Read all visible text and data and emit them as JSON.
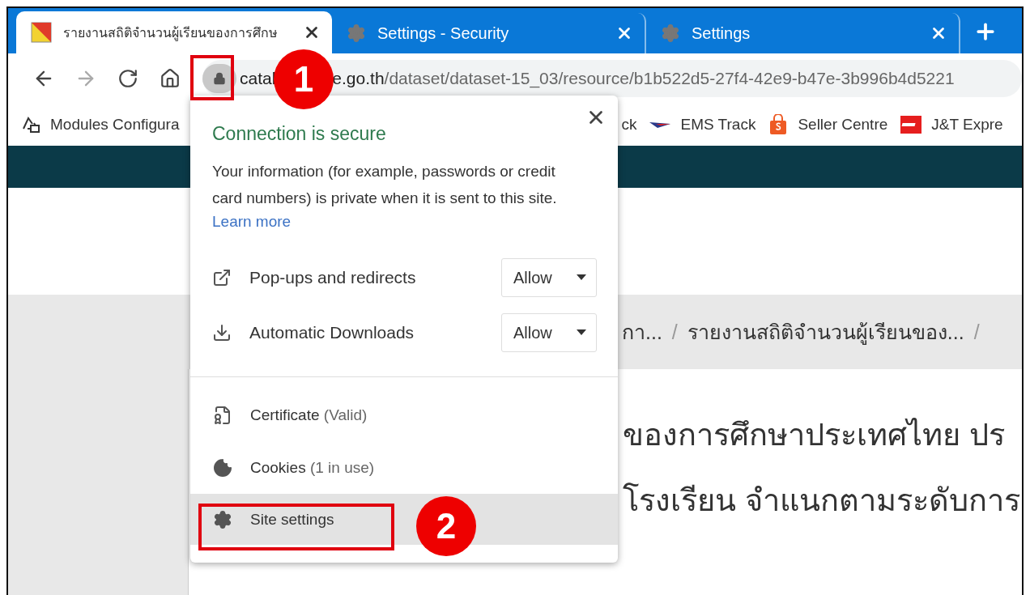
{
  "tabs": [
    {
      "title": "รายงานสถิติจำนวนผู้เรียนของการศึกษ",
      "kind": "site",
      "selected": true
    },
    {
      "title": "Settings - Security",
      "kind": "settings",
      "selected": false
    },
    {
      "title": "Settings",
      "kind": "settings",
      "selected": false
    }
  ],
  "nav_buttons": [
    {
      "kind": "back",
      "disabled": false
    },
    {
      "kind": "forward",
      "disabled": true
    },
    {
      "kind": "reload",
      "disabled": false
    },
    {
      "kind": "home",
      "disabled": false
    }
  ],
  "address": {
    "host_start": "catal",
    "host_end": "e.go.th",
    "path": "/dataset/dataset-15_03/resource/b1b522d5-27f4-42e9-b47e-3b996b4d5221"
  },
  "bookmarks": [
    {
      "label": "Modules Configura",
      "kind": "modules"
    },
    {
      "label": "ck",
      "kind": "plain"
    },
    {
      "label": "EMS Track",
      "kind": "ems"
    },
    {
      "label": "Seller Centre",
      "kind": "shop"
    },
    {
      "label": "J&T Expre",
      "kind": "jt"
    }
  ],
  "page": {
    "breadcrumb": [
      "กา...",
      "รายงานสถิติจำนวนผู้เรียนของ..."
    ],
    "breadcrumb_separator": "/",
    "heading_lines": [
      "ของการศึกษาประเทศไทย ปร",
      "โรงเรียน จำแนกตามระดับการ"
    ]
  },
  "popup": {
    "title": "Connection is secure",
    "description": "Your information (for example, passwords or credit card numbers) is private when it is sent to this site.",
    "learn_more": "Learn more",
    "permissions": [
      {
        "kind": "popups",
        "label": "Pop-ups and redirects",
        "value": "Allow"
      },
      {
        "kind": "downloads",
        "label": "Automatic Downloads",
        "value": "Allow"
      }
    ],
    "items": [
      {
        "kind": "certificate",
        "label": "Certificate",
        "detail": "(Valid)",
        "selected": false
      },
      {
        "kind": "cookies",
        "label": "Cookies",
        "detail": "(1 in use)",
        "selected": false
      },
      {
        "kind": "settings",
        "label": "Site settings",
        "selected": true
      }
    ]
  },
  "callouts": [
    {
      "number": "1"
    },
    {
      "number": "2"
    }
  ]
}
